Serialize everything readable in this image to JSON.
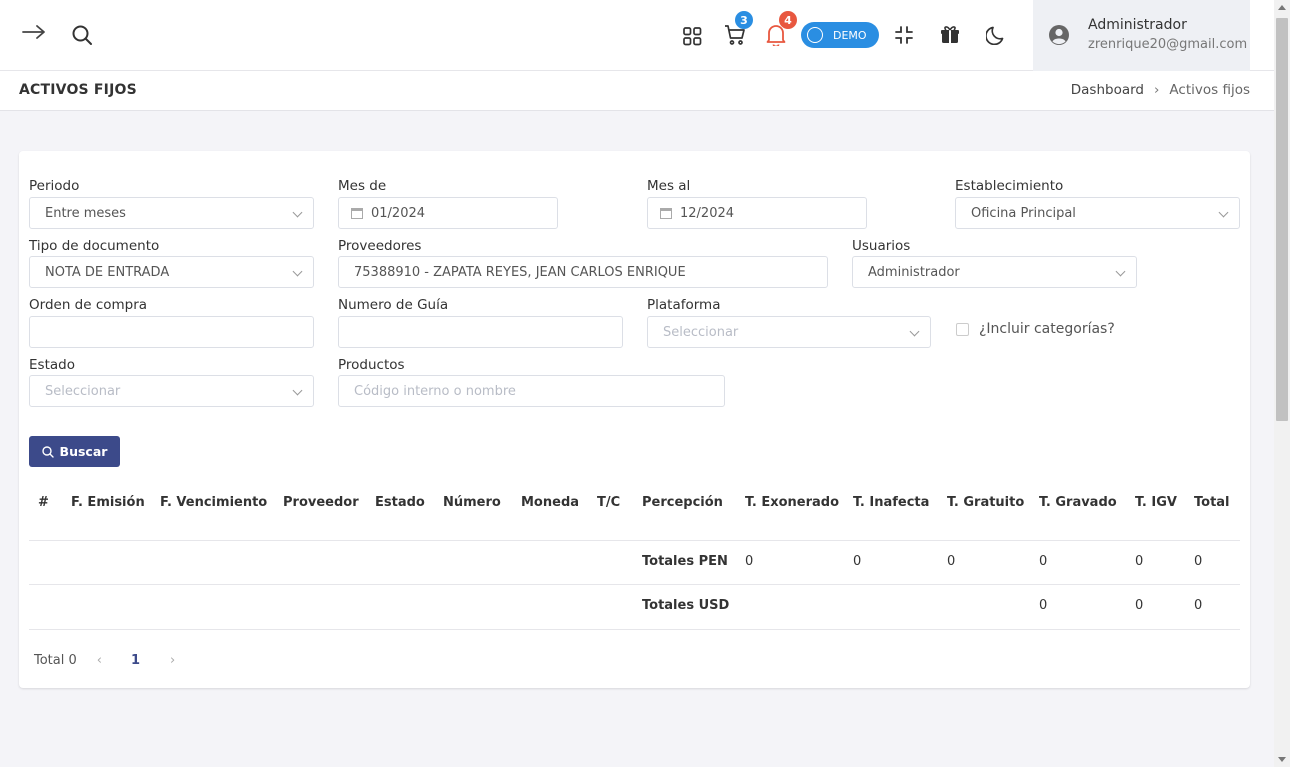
{
  "topbar": {
    "cart_badge": "3",
    "bell_badge": "4",
    "demo_label": "DEMO",
    "user_name": "Administrador",
    "user_email": "zrenrique20@gmail.com",
    "colors": {
      "cart_badge": "#2a8ee2",
      "bell_badge": "#e8573f",
      "demo_pill": "#2a8ee2"
    }
  },
  "page": {
    "title": "ACTIVOS FIJOS",
    "breadcrumb": [
      "Dashboard",
      "Activos fijos"
    ]
  },
  "filters": {
    "periodo": {
      "label": "Periodo",
      "value": "Entre meses"
    },
    "mes_de": {
      "label": "Mes de",
      "value": "01/2024"
    },
    "mes_al": {
      "label": "Mes al",
      "value": "12/2024"
    },
    "establecimiento": {
      "label": "Establecimiento",
      "value": "Oficina Principal"
    },
    "tipo_documento": {
      "label": "Tipo de documento",
      "value": "NOTA DE ENTRADA"
    },
    "proveedores": {
      "label": "Proveedores",
      "value": "75388910 - ZAPATA REYES, JEAN CARLOS ENRIQUE"
    },
    "usuarios": {
      "label": "Usuarios",
      "value": "Administrador"
    },
    "orden_compra": {
      "label": "Orden de compra",
      "value": ""
    },
    "numero_guia": {
      "label": "Numero de Guía",
      "value": ""
    },
    "plataforma": {
      "label": "Plataforma",
      "placeholder": "Seleccionar"
    },
    "incluir_categorias": {
      "label": "¿Incluir categorías?",
      "checked": false
    },
    "estado": {
      "label": "Estado",
      "placeholder": "Seleccionar"
    },
    "productos": {
      "label": "Productos",
      "placeholder": "Código interno o nombre"
    },
    "search_button": "Buscar",
    "colors": {
      "primary_button": "#3c4a8a"
    }
  },
  "table": {
    "columns": [
      "#",
      "F. Emisión",
      "F. Vencimiento",
      "Proveedor",
      "Estado",
      "Número",
      "Moneda",
      "T/C",
      "Percepción",
      "T. Exonerado",
      "T. Inafecta",
      "T. Gratuito",
      "T. Gravado",
      "T. IGV",
      "Total"
    ],
    "totals_pen": {
      "label": "Totales PEN",
      "exonerado": "0",
      "inafecta": "0",
      "gratuito": "0",
      "gravado": "0",
      "igv": "0",
      "total": "0"
    },
    "totals_usd": {
      "label": "Totales USD",
      "gravado": "0",
      "igv": "0",
      "total": "0"
    }
  },
  "pagination": {
    "total_label": "Total 0",
    "current_page": "1"
  }
}
